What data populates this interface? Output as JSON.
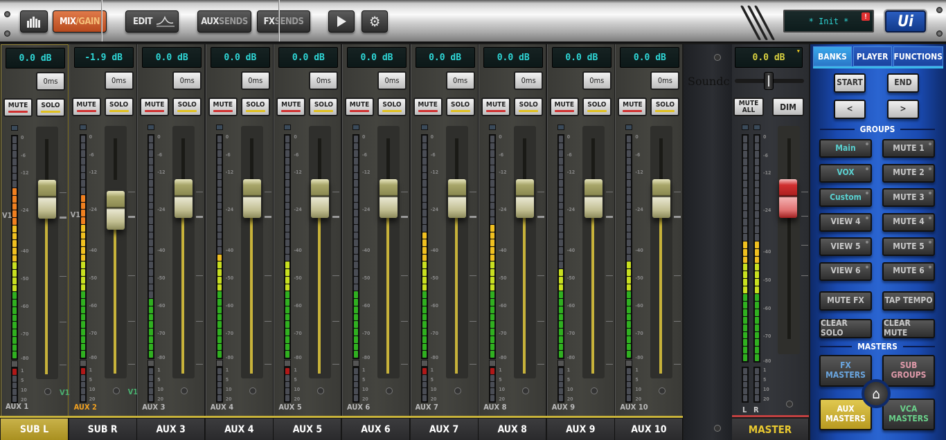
{
  "toolbar": {
    "meters_icon": "meters-icon",
    "mix_label": "MIX",
    "gain_label": "/GAIN",
    "edit_label": "EDIT",
    "aux_label": "AUX",
    "aux_sends": "SENDS",
    "fx_label": "FX",
    "fx_sends": "SENDS",
    "play_icon": "play-icon",
    "settings_icon": "gear-icon",
    "status_text": "* Init *",
    "warning": "!",
    "logo": "Ui"
  },
  "channels": [
    {
      "display": "0.0 dB",
      "delay": "0ms",
      "mute": "MUTE",
      "solo": "SOLO",
      "name": "AUX 1",
      "footer": "SUB L",
      "vca": "V1",
      "vca2": "V1",
      "meter": 0.76,
      "fader_db": 0.0,
      "selected": true
    },
    {
      "display": "-1.9 dB",
      "delay": "0ms",
      "mute": "MUTE",
      "solo": "SOLO",
      "name": "AUX 2",
      "footer": "SUB R",
      "vca": "V1",
      "vca2": "V1",
      "meter": 0.72,
      "fader_db": -1.9,
      "selected": false
    },
    {
      "display": "0.0 dB",
      "delay": "0ms",
      "mute": "MUTE",
      "solo": "SOLO",
      "name": "AUX 3",
      "footer": "AUX 3",
      "meter": 0.28,
      "fader_db": 0.0,
      "selected": false
    },
    {
      "display": "0.0 dB",
      "delay": "0ms",
      "mute": "MUTE",
      "solo": "SOLO",
      "name": "AUX 4",
      "footer": "AUX 4",
      "meter": 0.45,
      "fader_db": 0.0,
      "selected": false
    },
    {
      "display": "0.0 dB",
      "delay": "0ms",
      "mute": "MUTE",
      "solo": "SOLO",
      "name": "AUX 5",
      "footer": "AUX 5",
      "meter": 0.42,
      "fader_db": 0.0,
      "selected": false
    },
    {
      "display": "0.0 dB",
      "delay": "0ms",
      "mute": "MUTE",
      "solo": "SOLO",
      "name": "AUX 6",
      "footer": "AUX 6",
      "meter": 0.3,
      "fader_db": 0.0,
      "selected": false
    },
    {
      "display": "0.0 dB",
      "delay": "0ms",
      "mute": "MUTE",
      "solo": "SOLO",
      "name": "AUX 7",
      "footer": "AUX 7",
      "meter": 0.56,
      "fader_db": 0.0,
      "selected": false
    },
    {
      "display": "0.0 dB",
      "delay": "0ms",
      "mute": "MUTE",
      "solo": "SOLO",
      "name": "AUX 8",
      "footer": "AUX 8",
      "meter": 0.6,
      "fader_db": 0.0,
      "selected": false
    },
    {
      "display": "0.0 dB",
      "delay": "0ms",
      "mute": "MUTE",
      "solo": "SOLO",
      "name": "AUX 9",
      "footer": "AUX 9",
      "meter": 0.4,
      "fader_db": 0.0,
      "selected": false
    },
    {
      "display": "0.0 dB",
      "delay": "0ms",
      "mute": "MUTE",
      "solo": "SOLO",
      "name": "AUX 10",
      "footer": "AUX 10",
      "meter": 0.42,
      "fader_db": 0.0,
      "selected": false
    }
  ],
  "meter_scale": [
    "0",
    "-6",
    "-12",
    "-24",
    "-40",
    "-50",
    "-60",
    "-70",
    "-80"
  ],
  "clip_scale": [
    "1",
    "5",
    "10",
    "20"
  ],
  "brand": "Soundc",
  "master": {
    "display": "0.0 dB",
    "mute_all": "MUTE ALL",
    "dim": "DIM",
    "left": "L",
    "right": "R",
    "footer": "MASTER",
    "meter": 0.52
  },
  "panel": {
    "tabs": [
      "BANKS",
      "PLAYER",
      "FUNCTIONS"
    ],
    "active_tab": "BANKS",
    "start": "START",
    "end": "END",
    "prev": "<",
    "next": ">",
    "groups_title": "GROUPS",
    "views": [
      "Main",
      "VOX",
      "Custom",
      "VIEW 4",
      "VIEW 5",
      "VIEW 6"
    ],
    "mutes": [
      "MUTE 1",
      "MUTE 2",
      "MUTE 3",
      "MUTE 4",
      "MUTE 5",
      "MUTE 6"
    ],
    "mute_fx": "MUTE FX",
    "tap_tempo": "TAP TEMPO",
    "clear_solo": "CLEAR SOLO",
    "clear_mute": "CLEAR MUTE",
    "masters_title": "MASTERS",
    "fx_masters": [
      "FX",
      "MASTERS"
    ],
    "sub_groups": [
      "SUB",
      "GROUPS"
    ],
    "aux_masters": [
      "AUX",
      "MASTERS"
    ],
    "vca_masters": [
      "VCA",
      "MASTERS"
    ],
    "home_icon": "home-icon"
  },
  "colors": {
    "accent_orange": "#c8582a",
    "lcd_cyan": "#2fd6d6",
    "aux_masters_yellow": "#c9b24a",
    "mute_red": "#d03030",
    "solo_yellow": "#e0c020",
    "aux2_orange": "#f0a020"
  }
}
